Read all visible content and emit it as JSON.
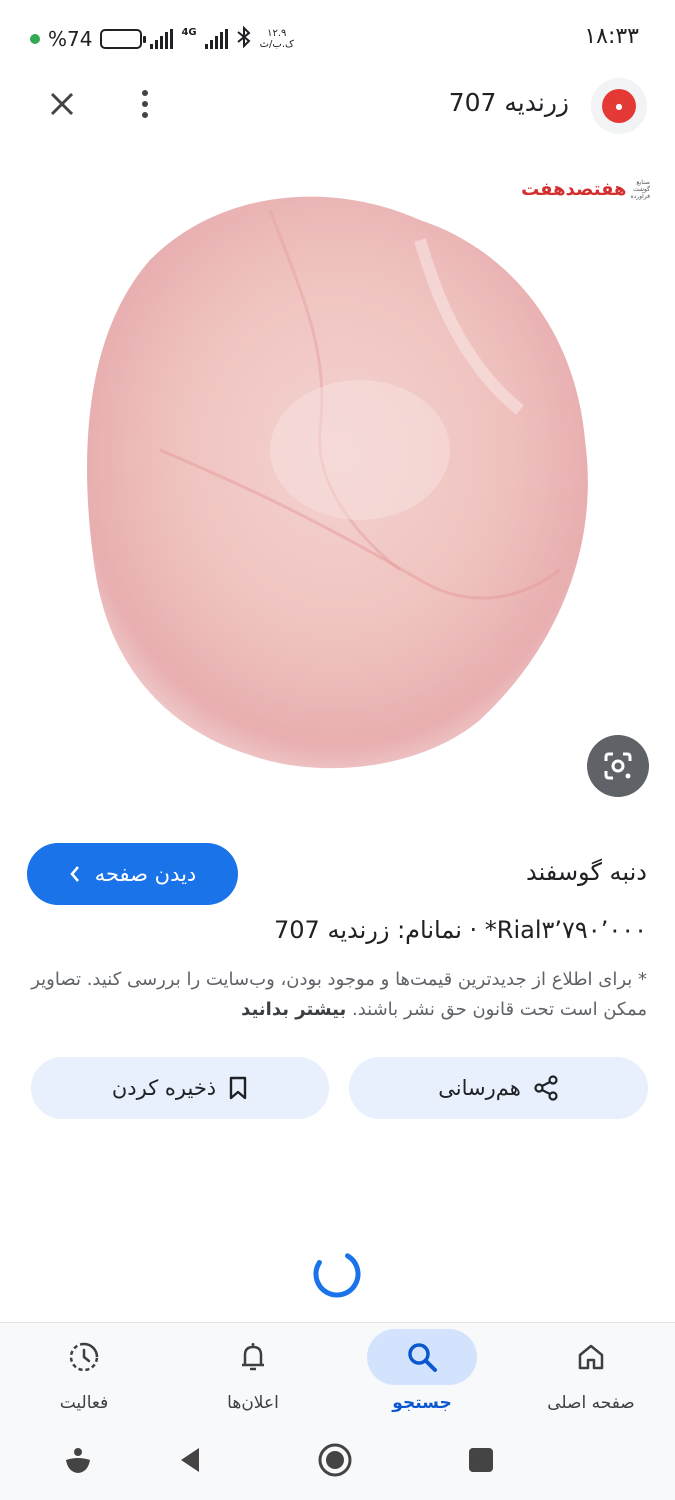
{
  "status_bar": {
    "time": "۱۸:۳۳",
    "battery_percent": "%74",
    "battery_level": 0.74,
    "network": "4G",
    "speed_value": "۱۲.۹",
    "speed_unit": "ک.ب/ث"
  },
  "header": {
    "site_name": "زرندیه 707",
    "logo_text": "هفت\nهفتصد"
  },
  "image": {
    "watermark_text": "هفتصدهفت",
    "watermark_small": "صنایع\nگوشت\nفرآورده"
  },
  "item": {
    "title": "دنبه گوسفند",
    "visit_label": "دیدن صفحه",
    "price_line": "Rial۳٬۷۹۰٬۰۰۰* · نمانام: زرندیه 707",
    "notice": "* برای اطلاع از جدیدترین قیمت‌ها و موجود بودن، وب‌سایت را بررسی کنید. تصاویر ممکن است تحت قانون حق نشر باشند.",
    "learn_more": "بیشتر بدانید"
  },
  "actions": {
    "share_label": "هم‌رسانی",
    "save_label": "ذخیره کردن"
  },
  "bottom_nav": {
    "home": "صفحه اصلی",
    "search": "جستجو",
    "notifications": "اعلان‌ها",
    "activity": "فعالیت"
  },
  "colors": {
    "accent": "#1a73e8",
    "pill_bg": "#e8f0fe",
    "nav_active_bg": "#d3e3fd"
  }
}
